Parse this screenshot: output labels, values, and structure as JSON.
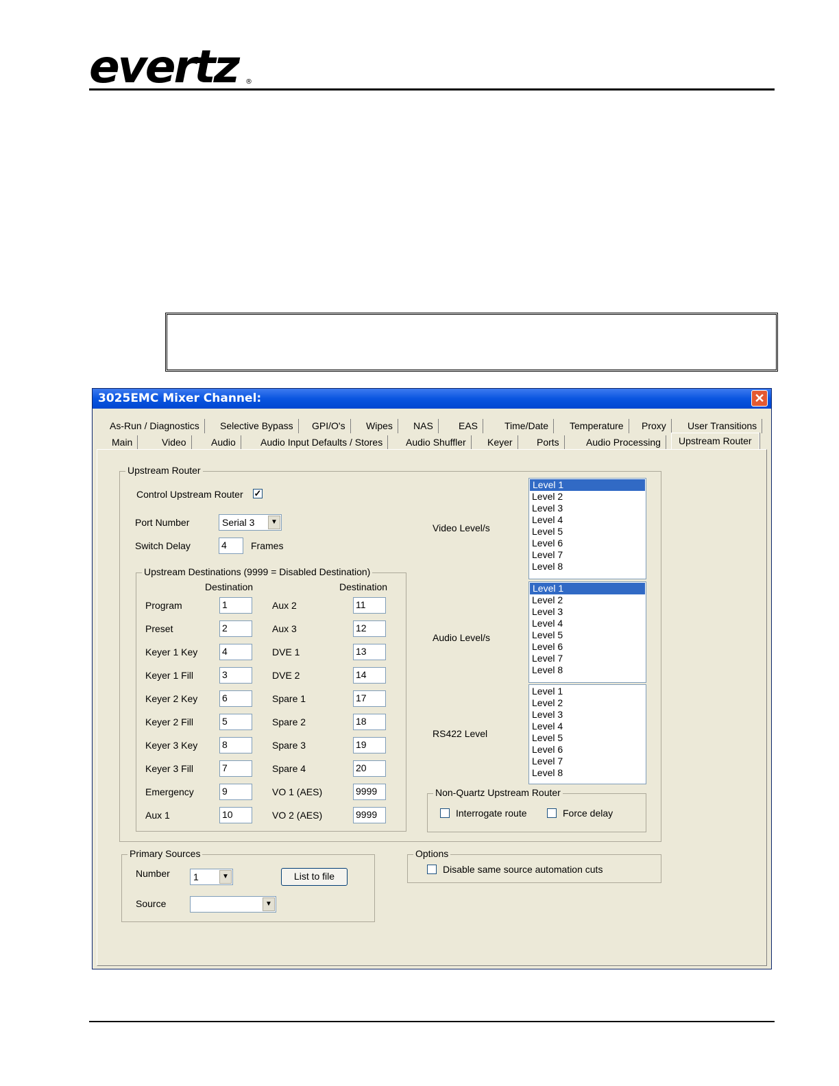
{
  "page": {
    "logo_text": "evertz",
    "logo_mark": "®"
  },
  "window": {
    "title": "3025EMC Mixer Channel:",
    "close_glyph": "✕"
  },
  "tabs": {
    "row1": [
      "As-Run / Diagnostics",
      "Selective Bypass",
      "GPI/O's",
      "Wipes",
      "NAS",
      "EAS",
      "Time/Date",
      "Temperature",
      "Proxy",
      "User Transitions"
    ],
    "row2": [
      "Main",
      "Video",
      "Audio",
      "Audio Input Defaults / Stores",
      "Audio Shuffler",
      "Keyer",
      "Ports",
      "Audio Processing"
    ],
    "active": "Upstream Router"
  },
  "upstream_router": {
    "group_label": "Upstream Router",
    "control_label": "Control Upstream Router",
    "control_checked": "✓",
    "port_label": "Port Number",
    "port_value": "Serial 3",
    "delay_label": "Switch Delay",
    "delay_value": "4",
    "delay_unit": "Frames"
  },
  "destinations": {
    "group_label": "Upstream Destinations (9999 = Disabled Destination)",
    "col_header": "Destination",
    "left": [
      {
        "label": "Program",
        "value": "1"
      },
      {
        "label": "Preset",
        "value": "2"
      },
      {
        "label": "Keyer 1 Key",
        "value": "4"
      },
      {
        "label": "Keyer 1 Fill",
        "value": "3"
      },
      {
        "label": "Keyer 2 Key",
        "value": "6"
      },
      {
        "label": "Keyer 2 Fill",
        "value": "5"
      },
      {
        "label": "Keyer 3 Key",
        "value": "8"
      },
      {
        "label": "Keyer 3 Fill",
        "value": "7"
      },
      {
        "label": "Emergency",
        "value": "9"
      },
      {
        "label": "Aux 1",
        "value": "10"
      }
    ],
    "right": [
      {
        "label": "Aux 2",
        "value": "11"
      },
      {
        "label": "Aux 3",
        "value": "12"
      },
      {
        "label": "DVE 1",
        "value": "13"
      },
      {
        "label": "DVE 2",
        "value": "14"
      },
      {
        "label": "Spare 1",
        "value": "17"
      },
      {
        "label": "Spare 2",
        "value": "18"
      },
      {
        "label": "Spare 3",
        "value": "19"
      },
      {
        "label": "Spare 4",
        "value": "20"
      },
      {
        "label": "VO 1 (AES)",
        "value": "9999"
      },
      {
        "label": "VO 2 (AES)",
        "value": "9999"
      }
    ]
  },
  "levels": {
    "video_label": "Video Level/s",
    "audio_label": "Audio Level/s",
    "rs422_label": "RS422 Level",
    "items": [
      "Level 1",
      "Level 2",
      "Level 3",
      "Level 4",
      "Level 5",
      "Level 6",
      "Level 7",
      "Level 8"
    ],
    "video_selected": "Level 1",
    "audio_selected": "Level 1",
    "selection_color": "#316ac5"
  },
  "non_quartz": {
    "group_label": "Non-Quartz Upstream Router",
    "interrogate_label": "Interrogate route",
    "force_delay_label": "Force delay"
  },
  "primary_sources": {
    "group_label": "Primary Sources",
    "number_label": "Number",
    "number_value": "1",
    "source_label": "Source",
    "source_value": "",
    "list_button": "List to file"
  },
  "options": {
    "group_label": "Options",
    "disable_label": "Disable same source automation cuts"
  },
  "icons": {
    "dropdown": "▼"
  }
}
